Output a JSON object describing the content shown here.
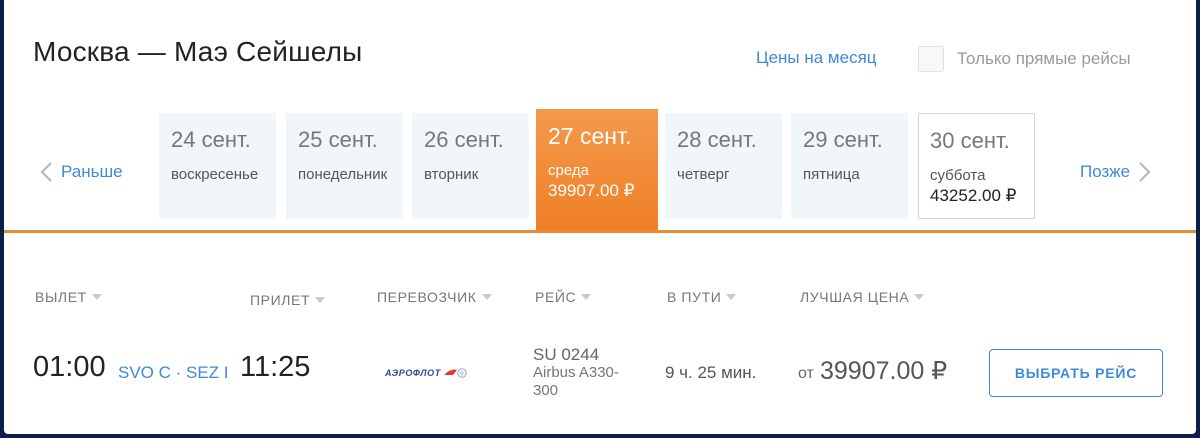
{
  "header": {
    "title": "Москва — Маэ Сейшелы",
    "month_prices_link": "Цены на месяц",
    "direct_only_label": "Только прямые рейсы",
    "direct_only_checked": false
  },
  "date_nav": {
    "prev_label": "Раньше",
    "next_label": "Позже",
    "dates": [
      {
        "date": "24 сент.",
        "day": "воскресенье",
        "price": "",
        "state": "default"
      },
      {
        "date": "25 сент.",
        "day": "понедельник",
        "price": "",
        "state": "default"
      },
      {
        "date": "26 сент.",
        "day": "вторник",
        "price": "",
        "state": "default"
      },
      {
        "date": "27 сент.",
        "day": "среда",
        "price": "39907.00 ₽",
        "state": "active"
      },
      {
        "date": "28 сент.",
        "day": "четверг",
        "price": "",
        "state": "default"
      },
      {
        "date": "29 сент.",
        "day": "пятница",
        "price": "",
        "state": "default"
      },
      {
        "date": "30 сент.",
        "day": "суббота",
        "price": "43252.00 ₽",
        "state": "bordered"
      }
    ]
  },
  "table": {
    "headers": {
      "departure": "ВЫЛЕТ",
      "arrival": "ПРИЛЕТ",
      "carrier": "ПЕРЕВОЗЧИК",
      "flight": "РЕЙС",
      "duration": "В ПУТИ",
      "best_price": "ЛУЧШАЯ ЦЕНА"
    },
    "rows": [
      {
        "departure_time": "01:00",
        "airports": "SVO C · SEZ I",
        "arrival_time": "11:25",
        "carrier_logo_text": "АЭРОФЛОТ",
        "flight_number": "SU 0244",
        "aircraft": "Airbus A330-300",
        "duration": "9 ч. 25 мин.",
        "price_prefix": "от",
        "price": "39907.00 ₽",
        "select_label": "ВЫБРАТЬ РЕЙС"
      }
    ]
  },
  "colors": {
    "accent": "#ef8a34",
    "link": "#3d8ad8",
    "tab_bg": "#f1f6fb"
  },
  "icons": {
    "prev": "chevron-left-icon",
    "next": "chevron-right-icon",
    "carrier": "aeroflot-logo"
  }
}
